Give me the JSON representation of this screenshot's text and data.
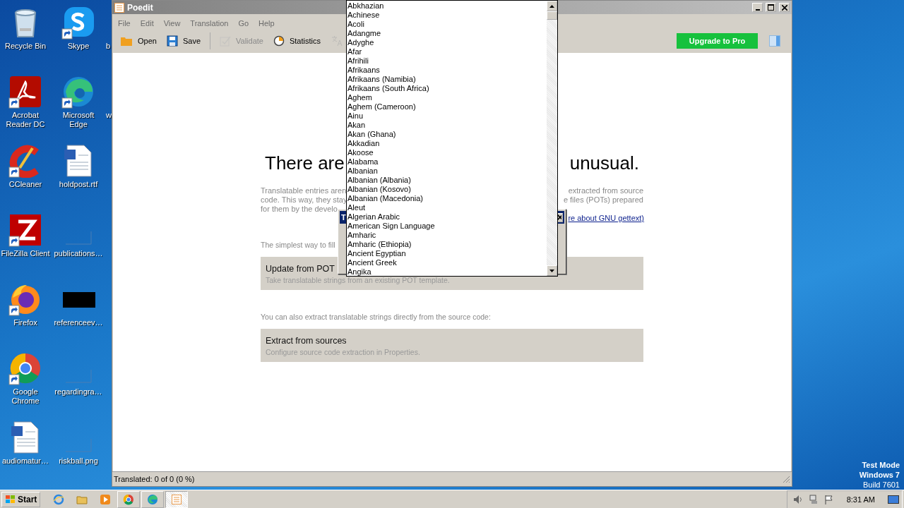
{
  "desktop": {
    "icons": [
      {
        "label": "Recycle Bin",
        "kind": "trash",
        "shortcut": false
      },
      {
        "label": "Acrobat Reader DC",
        "kind": "acrobat",
        "shortcut": true
      },
      {
        "label": "CCleaner",
        "kind": "ccleaner",
        "shortcut": true
      },
      {
        "label": "FileZilla Client",
        "kind": "filezilla",
        "shortcut": true
      },
      {
        "label": "Firefox",
        "kind": "firefox",
        "shortcut": true
      },
      {
        "label": "Google Chrome",
        "kind": "chrome",
        "shortcut": true
      },
      {
        "label": "audiomatur…",
        "kind": "worddoc",
        "shortcut": false
      },
      {
        "label": "Skype",
        "kind": "skype",
        "shortcut": true
      },
      {
        "label": "Microsoft Edge",
        "kind": "edge",
        "shortcut": true
      },
      {
        "label": "holdpost.rtf",
        "kind": "worddoc",
        "shortcut": false
      },
      {
        "label": "publications…",
        "kind": "blank",
        "shortcut": false
      },
      {
        "label": "referenceev…",
        "kind": "black",
        "shortcut": false
      },
      {
        "label": "regardingra…",
        "kind": "blank",
        "shortcut": false
      },
      {
        "label": "riskball.png",
        "kind": "blank",
        "shortcut": false
      }
    ],
    "cut_labels": [
      "b",
      "w"
    ],
    "os_notice": [
      "Test Mode",
      "Windows 7",
      "Build 7601"
    ]
  },
  "window": {
    "title": "Poedit",
    "menu": [
      "File",
      "Edit",
      "View",
      "Translation",
      "Go",
      "Help"
    ],
    "toolbar": [
      {
        "kind": "open",
        "label": "Open",
        "disabled": false
      },
      {
        "kind": "save",
        "label": "Save",
        "disabled": false
      },
      {
        "kind": "separator"
      },
      {
        "kind": "validate",
        "label": "Validate",
        "disabled": true
      },
      {
        "kind": "statistics",
        "label": "Statistics",
        "disabled": false
      },
      {
        "kind": "translate",
        "disabled": true
      }
    ],
    "upgrade_button": "Upgrade to Pro",
    "heading": [
      "There are",
      "unusual."
    ],
    "intro_lines": [
      {
        "left": "Translatable entries aren",
        "right": "extracted from source"
      },
      {
        "left": "code. This way, they stay",
        "right": "e files (POTs) prepared"
      },
      {
        "left": "for them by the develo"
      }
    ],
    "link": "re about GNU gettext)",
    "simplest": "The simplest way to fill",
    "cards": [
      {
        "title": "Update from POT",
        "subtitle": "Take translatable strings from an existing POT template."
      }
    ],
    "extract_note": "You can also extract translatable strings directly from the source code:",
    "extract_card": {
      "title": "Extract from sources",
      "subtitle": "Configure source code extraction in Properties."
    },
    "status": "Translated: 0 of 0 (0 %)"
  },
  "dialog": {
    "title": "T"
  },
  "language_list": {
    "items": [
      "Abkhazian",
      "Achinese",
      "Acoli",
      "Adangme",
      "Adyghe",
      "Afar",
      "Afrihili",
      "Afrikaans",
      "Afrikaans (Namibia)",
      "Afrikaans (South Africa)",
      "Aghem",
      "Aghem (Cameroon)",
      "Ainu",
      "Akan",
      "Akan (Ghana)",
      "Akkadian",
      "Akoose",
      "Alabama",
      "Albanian",
      "Albanian (Albania)",
      "Albanian (Kosovo)",
      "Albanian (Macedonia)",
      "Aleut",
      "Algerian Arabic",
      "American Sign Language",
      "Amharic",
      "Amharic (Ethiopia)",
      "Ancient Egyptian",
      "Ancient Greek",
      "Angika"
    ]
  },
  "taskbar": {
    "start": "Start",
    "apps": [
      {
        "kind": "ie",
        "active": false
      },
      {
        "kind": "folder",
        "active": false
      },
      {
        "kind": "media",
        "active": false
      },
      {
        "kind": "chrome",
        "active": false
      },
      {
        "kind": "edge",
        "active": false
      },
      {
        "kind": "poedit",
        "active": true
      }
    ],
    "clock": "8:31 AM"
  }
}
